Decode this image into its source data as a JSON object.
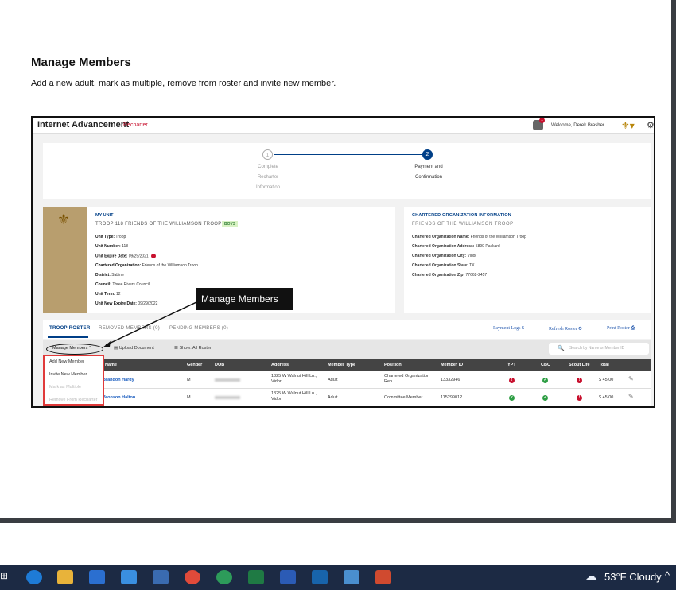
{
  "doc": {
    "heading": "Manage Members",
    "description": "Add a new adult, mark as multiple, remove from roster and invite new member."
  },
  "app": {
    "brand": "Internet Advancement",
    "mode": "Recharter",
    "notification_count": "1",
    "welcome": "Welcome, Derek Brasher"
  },
  "steps": [
    {
      "num": "1",
      "label_lines": [
        "Complete",
        "Recharter",
        "Information"
      ]
    },
    {
      "num": "2",
      "label_lines": [
        "Payment and",
        "Confirmation"
      ]
    }
  ],
  "unit": {
    "section_title": "MY UNIT",
    "name": "TROOP 118 FRIENDS OF THE WILLIAMSON TROOP",
    "badge": "BOYS",
    "rows": [
      {
        "label": "Unit Type:",
        "value": "Troop"
      },
      {
        "label": "Unit Number:",
        "value": "118"
      },
      {
        "label": "Unit Expire Date:",
        "value": "09/29/2021"
      },
      {
        "label": "Chartered Organization:",
        "value": "Friends of the Williamson Troop"
      },
      {
        "label": "District:",
        "value": "Sabine"
      },
      {
        "label": "Council:",
        "value": "Three Rivers Council"
      },
      {
        "label": "Unit Term:",
        "value": "12"
      },
      {
        "label": "Unit New Expire Date:",
        "value": "09/29/2022"
      }
    ]
  },
  "org": {
    "section_title": "CHARTERED ORGANIZATION INFORMATION",
    "name": "FRIENDS OF THE WILLIAMSON TROOP",
    "rows": [
      {
        "label": "Chartered Organization Name:",
        "value": "Friends of the Williamson Troop"
      },
      {
        "label": "Chartered Organization Address:",
        "value": "5890 Packard"
      },
      {
        "label": "Chartered Organization City:",
        "value": "Vidor"
      },
      {
        "label": "Chartered Organization State:",
        "value": "TX"
      },
      {
        "label": "Chartered Organization Zip:",
        "value": "77662-2457"
      }
    ]
  },
  "callout": "Manage Members",
  "tabs": {
    "roster": "TROOP ROSTER",
    "removed": "REMOVED MEMBERS (0)",
    "pending": "PENDING MEMBERS (0)",
    "payment_logs": "Payment Logs",
    "refresh": "Refresh Roster",
    "print": "Print Roster"
  },
  "toolbar": {
    "manage": "Manage Members",
    "upload": "Upload Document",
    "show": "Show: All Roster",
    "search_placeholder": "Search by Name or Member ID"
  },
  "menu": [
    "Add New Member",
    "Invite New Member",
    "Mark as Multiple",
    "Remove From Recharter"
  ],
  "columns": [
    "Name",
    "Gender",
    "DOB",
    "Address",
    "Member Type",
    "Position",
    "Member ID",
    "YPT",
    "CBC",
    "Scout Life",
    "Total"
  ],
  "rows": [
    {
      "name": "Brandon Hardy",
      "gender": "M",
      "address": "1325 W Walnut Hill Ln., Vidor",
      "member_type": "Adult",
      "position": "Chartered Organization Rep.",
      "member_id": "13332946",
      "ypt": "red",
      "cbc": "green",
      "scout_life": "red",
      "total": "$ 45.00"
    },
    {
      "name": "Bronson Halton",
      "gender": "M",
      "address": "1325 W Walnut Hill Ln., Vidor",
      "member_type": "Adult",
      "position": "Committee Member",
      "member_id": "115299012",
      "ypt": "green",
      "cbc": "green",
      "scout_life": "red",
      "total": "$ 45.00"
    }
  ],
  "taskbar": {
    "weather": "53°F  Cloudy"
  }
}
